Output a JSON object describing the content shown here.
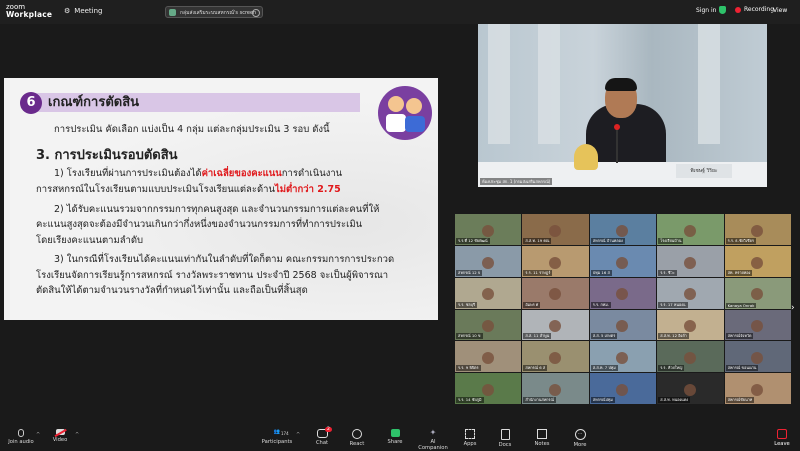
{
  "topbar": {
    "brand_line1": "zoom",
    "brand_line2": "Workplace",
    "meeting_tab": "Meeting",
    "window_title": "กลุ่มส่งเสริมระบบสหกรณ์'s screen",
    "sign_in": "Sign in",
    "recording": "Recording",
    "view": "View"
  },
  "slide": {
    "number": "6",
    "title": "เกณฑ์การตัดสิน",
    "line1": "การประเมิน คัดเลือก แบ่งเป็น 4 กลุ่ม แต่ละกลุ่มประเมิน 3 รอบ ดังนี้",
    "section_heading": "3. การประเมินรอบตัดสิน",
    "p1a_pre": "1)  โรงเรียนที่ผ่านการประเมินต้องได้",
    "p1a_red": "ค่าเฉลี่ยของคะแนน",
    "p1a_post": "การดำเนินงาน",
    "p1b_pre": "การสหกรณ์ในโรงเรียนตามแบบประเมินโรงเรียนแต่ละด้าน",
    "p1b_red": "ไม่ต่ำกว่า 2.75",
    "p2a": "2) ได้รับคะแนนรวมจากกรรมการทุกคนสูงสุด และจำนวนกรรมการแต่ละคนที่ให้",
    "p2b": "คะแนนสูงสุดจะต้องมีจำนวนเกินกว่ากึ่งหนึ่งของจำนวนกรรมการที่ทำการประเมิน",
    "p2c": "โดยเรียงคะแนนตามลำดับ",
    "p3a": "3) ในกรณีที่โรงเรียนได้คะแนนเท่ากันในลำดับที่ใดก็ตาม คณะกรรมการการประกวด",
    "p3b": "โรงเรียนจัดการเรียนรู้การสหกรณ์ รางวัลพระราชทาน ประจำปี 2568 จะเป็นผู้พิจารณา",
    "p3c": "ตัดสินให้ได้ตามจำนวนรางวัลที่กำหนดไว้เท่านั้น และถือเป็นที่สิ้นสุด",
    "colors": {
      "purple": "#6a2a8c",
      "red": "#e0181b"
    }
  },
  "speaker": {
    "caption": "ห้องประชุม สก. 1 (กรมส่งเสริมสหกรณ์)",
    "nameplate": "พิเชษฐ์ วิริยะ"
  },
  "gallery": {
    "tiles": [
      {
        "cap": "ร.ร.ที่ 12 ชัยพัฒน์",
        "bg": "#6b7d5a"
      },
      {
        "cap": "ส.ส.ท. 19 คณ",
        "bg": "#8a6b4a"
      },
      {
        "cap": "สหกรณ์ บ้านคลอง",
        "bg": "#5b7fa0"
      },
      {
        "cap": "โรงเรียนบ้าน",
        "bg": "#7a9a6a"
      },
      {
        "cap": "ร.ร. ธ.ชัยวิเชียร",
        "bg": "#a88c5a"
      },
      {
        "cap": "สหกรณ์ 12 จ",
        "bg": "#8a9aa8"
      },
      {
        "cap": "ร.ร. 11 ราษฎร์",
        "bg": "#b89a70"
      },
      {
        "cap": "ปทุม 16 ส",
        "bg": "#6a8ab0"
      },
      {
        "cap": "ร.ร. ชีวะ",
        "bg": "#9aa0a8"
      },
      {
        "cap": "สท. ทรายทอง",
        "bg": "#c0a060"
      },
      {
        "cap": "ร.ร. ชลบุรี",
        "bg": "#b0a890"
      },
      {
        "cap": "อัมพร ศ",
        "bg": "#9a7a6a"
      },
      {
        "cap": "ร.ร. กทม.",
        "bg": "#7a6a8a"
      },
      {
        "cap": "ร.ร. 17 หนองแ",
        "bg": "#a0a8b0"
      },
      {
        "cap": "Kanaya Onrak",
        "bg": "#8a9a7a"
      },
      {
        "cap": "สหกรณ์ 10 ข",
        "bg": "#6a7a5a"
      },
      {
        "cap": "ส.ส. 11 ลำพูน",
        "bg": "#b0b4b8"
      },
      {
        "cap": "ส.ส. 5 เกษตร",
        "bg": "#7a8aa0"
      },
      {
        "cap": "ส.ส.ท. 12 อิงลำ",
        "bg": "#c2b090"
      },
      {
        "cap": "สหกรณ์จังหวัด",
        "bg": "#6a6a7a"
      },
      {
        "cap": "ร.ร. 9 พิจิตร",
        "bg": "#a0907a"
      },
      {
        "cap": "สหกรณ์ 6 ส",
        "bg": "#9a9070"
      },
      {
        "cap": "ส.ส.ท. 7 ปทุม",
        "bg": "#8aa0b0"
      },
      {
        "cap": "ร.ร. ห้วยใหญ่",
        "bg": "#5a6a5a"
      },
      {
        "cap": "สหกรณ์ ขอนแก่น",
        "bg": "#606878"
      },
      {
        "cap": "ร.ร. 14 ชัยภูมิ",
        "bg": "#5a7a4a"
      },
      {
        "cap": "สำนักงานสหกรณ์",
        "bg": "#7a8a8a"
      },
      {
        "cap": "สหกรณ์ปทุม",
        "bg": "#4a6a9a"
      },
      {
        "cap": "ส.ส.ท. หนองแดง",
        "bg": "#2a2a2a"
      },
      {
        "cap": "สหกรณ์ชัยนาท",
        "bg": "#b09070"
      }
    ]
  },
  "toolbar": {
    "join_audio": "Join audio",
    "video": "Video",
    "participants": "Participants",
    "participants_count": "174",
    "chat": "Chat",
    "chat_badge": "2",
    "react": "React",
    "share": "Share",
    "ai_companion": "AI Companion",
    "apps": "Apps",
    "docs": "Docs",
    "notes": "Notes",
    "more": "More",
    "leave": "Leave"
  }
}
